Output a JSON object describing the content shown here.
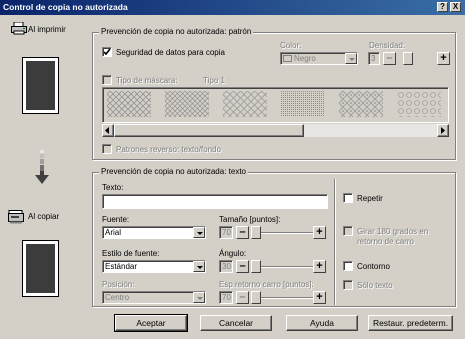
{
  "window": {
    "title": "Control de copia no autorizada",
    "help_btn": "?",
    "close_btn": "X"
  },
  "left": {
    "on_print_label": "Al imprimir",
    "on_copy_label": "Al copiar"
  },
  "pattern_group": {
    "legend": "Prevención de copia no autorizada: patrón",
    "data_security_label": "Seguridad de datos para copia",
    "data_security_checked": true,
    "color_label": "Color:",
    "color_value": "Negro",
    "density_label": "Densidad:",
    "density_value": "3",
    "mask_type_label": "Tipo de máscara:",
    "mask_type_value": "Tipo 1",
    "reverse_patterns_label": "Patrones reverso: texto/fondo"
  },
  "text_group": {
    "legend": "Prevención de copia no autorizada: texto",
    "text_label": "Texto:",
    "text_value": "",
    "font_label": "Fuente:",
    "font_value": "Arial",
    "size_label": "Tamaño [puntos]:",
    "size_value": "70",
    "style_label": "Estilo de fuente:",
    "style_value": "Estándar",
    "angle_label": "Ángulo:",
    "angle_value": "30",
    "position_label": "Posición:",
    "position_value": "Centro",
    "line_spacing_label": "Esp.retorno carro [puntos]:",
    "line_spacing_value": "70",
    "repeat_label": "Repetir",
    "rotate180_label": "Girar 180 grados en retorno de carro",
    "outline_label": "Contorno",
    "text_only_label": "Sólo texto"
  },
  "buttons": {
    "accept": "Aceptar",
    "cancel": "Cancelar",
    "help": "Ayuda",
    "restore": "Restaur. predeterm."
  },
  "colors": {
    "titlebar_start": "#0a246a",
    "titlebar_end": "#3a6ea5",
    "face": "#d4d0c8",
    "doc_fill": "#3c3c3c"
  }
}
